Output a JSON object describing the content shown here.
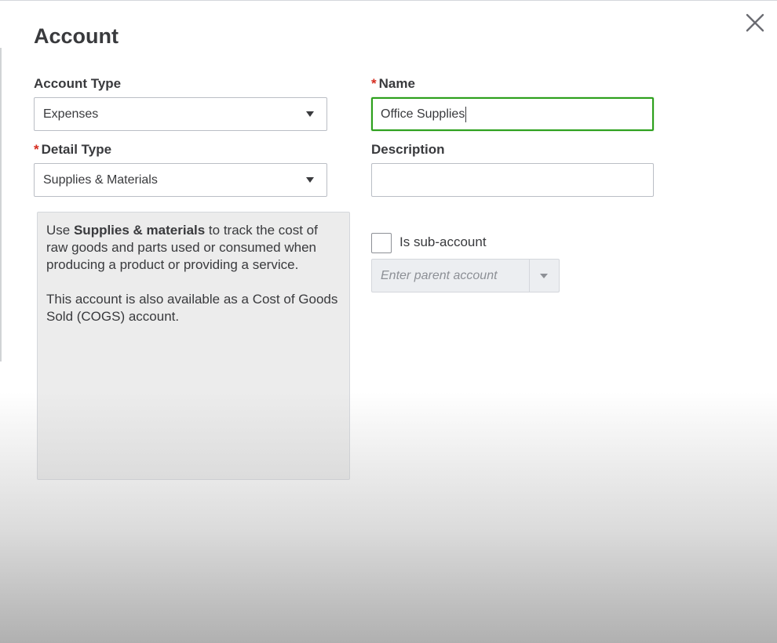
{
  "dialog": {
    "title": "Account",
    "close_icon": "close-icon"
  },
  "fields": {
    "account_type": {
      "label": "Account Type",
      "value": "Expenses"
    },
    "name": {
      "required_mark": "*",
      "label": "Name",
      "value": "Office Supplies"
    },
    "detail_type": {
      "required_mark": "*",
      "label": "Detail Type",
      "value": "Supplies & Materials"
    },
    "description": {
      "label": "Description",
      "value": ""
    }
  },
  "help": {
    "p1_prefix": "Use ",
    "p1_bold": "Supplies & materials",
    "p1_suffix": " to track the cost of raw goods and parts used or consumed when producing a product or providing a service.",
    "p2": "This account is also available as a Cost of Goods Sold (COGS) account."
  },
  "sub_account": {
    "checkbox_label": "Is sub-account",
    "checked": false,
    "parent_placeholder": "Enter parent account"
  },
  "colors": {
    "focus_border": "#2ca01c",
    "required": "#d52b1e",
    "text": "#393a3d"
  }
}
